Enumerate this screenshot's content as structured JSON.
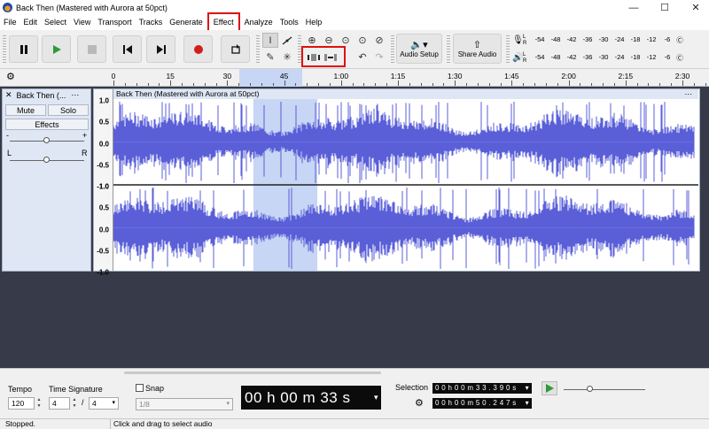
{
  "window": {
    "title": "Back Then (Mastered with Aurora at 50pct)",
    "minimize": "—",
    "maximize": "☐",
    "close": "✕"
  },
  "menu": [
    "File",
    "Edit",
    "Select",
    "View",
    "Transport",
    "Tracks",
    "Generate",
    "Effect",
    "Analyze",
    "Tools",
    "Help"
  ],
  "toolbar": {
    "audio_setup": "Audio Setup",
    "share_audio": "Share Audio",
    "meter_scale": [
      "-54",
      "-48",
      "-42",
      "-36",
      "-30",
      "-24",
      "-18",
      "-12",
      "-6",
      "0"
    ],
    "meter_channels": [
      "L",
      "R"
    ]
  },
  "ruler": {
    "ticks": [
      "0",
      "15",
      "30",
      "45",
      "1:00",
      "1:15",
      "1:30",
      "1:45",
      "2:00",
      "2:15",
      "2:30"
    ]
  },
  "track": {
    "name": "Back Then (...",
    "full_name": "Back Then (Mastered with Aurora at 50pct)",
    "mute": "Mute",
    "solo": "Solo",
    "effects": "Effects",
    "gain_minus": "-",
    "gain_plus": "+",
    "pan_left": "L",
    "pan_right": "R",
    "scale_labels": [
      "1.0",
      "0.5",
      "0.0",
      "-0.5",
      "-1.0"
    ],
    "selection_seconds": [
      33.39,
      50.247
    ]
  },
  "bottom": {
    "tempo_label": "Tempo",
    "tempo_value": "120",
    "time_sig_label": "Time Signature",
    "time_sig_num": "4",
    "time_sig_sep": "/",
    "time_sig_den": "4",
    "snap_label": "Snap",
    "snap_value": "1/8",
    "time_display": "00 h 00 m 33 s",
    "selection_label": "Selection",
    "selection_start": "0 0 h 0 0 m 3 3 . 3 9 0 s",
    "selection_end": "0 0 h 0 0 m 5 0 . 2 4 7 s"
  },
  "status": {
    "left": "Stopped.",
    "right": "Click and drag to select audio"
  },
  "colors": {
    "waveform": "#5a5fd8",
    "selection": "#c6d6f4",
    "highlight_box": "#e01010",
    "track_bg": "#373a48"
  }
}
